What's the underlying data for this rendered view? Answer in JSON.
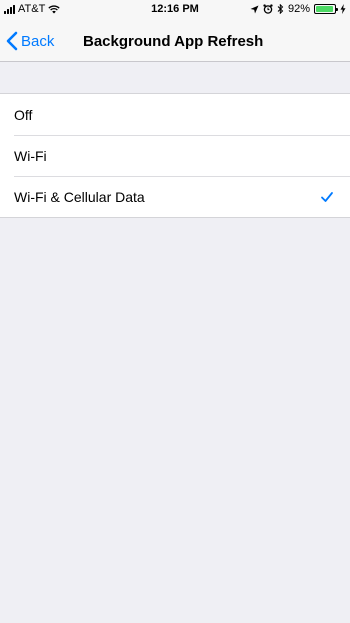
{
  "status_bar": {
    "carrier": "AT&T",
    "time": "12:16 PM",
    "battery_percent": "92%",
    "battery_level": 0.92,
    "battery_color": "#4cd964"
  },
  "nav": {
    "back_label": "Back",
    "title": "Background App Refresh",
    "accent_color": "#007aff"
  },
  "options": [
    {
      "label": "Off",
      "selected": false
    },
    {
      "label": "Wi-Fi",
      "selected": false
    },
    {
      "label": "Wi-Fi & Cellular Data",
      "selected": true
    }
  ]
}
